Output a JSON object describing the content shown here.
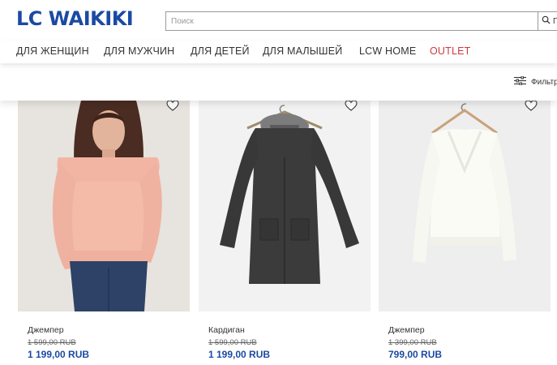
{
  "brand": {
    "logo_text": "LC WAIKIKI",
    "color": "#1b4aa3"
  },
  "search": {
    "placeholder": "Поиск",
    "value": "",
    "button_label": "П"
  },
  "nav": {
    "items": [
      {
        "label": "ДЛЯ ЖЕНЩИН"
      },
      {
        "label": "ДЛЯ МУЖЧИН"
      },
      {
        "label": "ДЛЯ ДЕТЕЙ"
      },
      {
        "label": "ДЛЯ МАЛЫШЕЙ"
      },
      {
        "label": "LCW HOME"
      },
      {
        "label": "OUTLET",
        "color": "#d0383f"
      }
    ]
  },
  "filter": {
    "label": "Фильтр",
    "icon": "filter-sliders-icon"
  },
  "products": [
    {
      "name": "Джемпер",
      "old_price": "1 599,00 RUB",
      "price": "1 199,00 RUB",
      "image": "woman-in-pink-sweater",
      "favorite_icon": "heart-icon"
    },
    {
      "name": "Кардиган",
      "old_price": "1 599,00 RUB",
      "price": "1 199,00 RUB",
      "image": "dark-grey-hooded-cardigan-on-hanger",
      "favorite_icon": "heart-icon"
    },
    {
      "name": "Джемпер",
      "old_price": "1 399,00 RUB",
      "price": "799,00 RUB",
      "image": "cream-v-neck-jumper-on-hanger",
      "favorite_icon": "heart-icon"
    }
  ]
}
